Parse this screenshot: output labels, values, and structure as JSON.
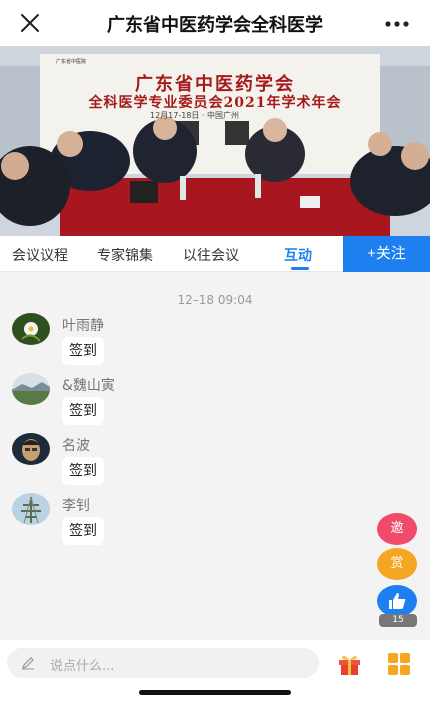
{
  "header": {
    "title": "广东省中医药学会全科医学"
  },
  "video": {
    "banner_title": "广东省中医药学会",
    "banner_subtitle": "全科医学专业委员会2021年学术年会",
    "banner_date": "12月17-18日 · 中国广州"
  },
  "tabs": [
    {
      "label": "会议议程"
    },
    {
      "label": "专家锦集"
    },
    {
      "label": "以往会议"
    },
    {
      "label": "互动",
      "active": true
    }
  ],
  "follow_label": "+关注",
  "chat": {
    "timestamp": "12–18 09:04",
    "messages": [
      {
        "user": "叶雨静",
        "text": "签到"
      },
      {
        "user": "&魏山寅",
        "text": "签到"
      },
      {
        "user": "名波",
        "text": "签到"
      },
      {
        "user": "李钊",
        "text": "签到"
      }
    ]
  },
  "floating": {
    "invite_label": "邀",
    "reward_label": "赏",
    "like_count": "15"
  },
  "composer": {
    "placeholder": "说点什么..."
  },
  "colors": {
    "accent": "#1d7ff0",
    "invite": "#f04b6a",
    "reward": "#f5a623"
  },
  "icons": [
    "close-icon",
    "more-icon",
    "thumbs-up-icon",
    "pencil-icon",
    "gift-icon",
    "apps-icon"
  ]
}
